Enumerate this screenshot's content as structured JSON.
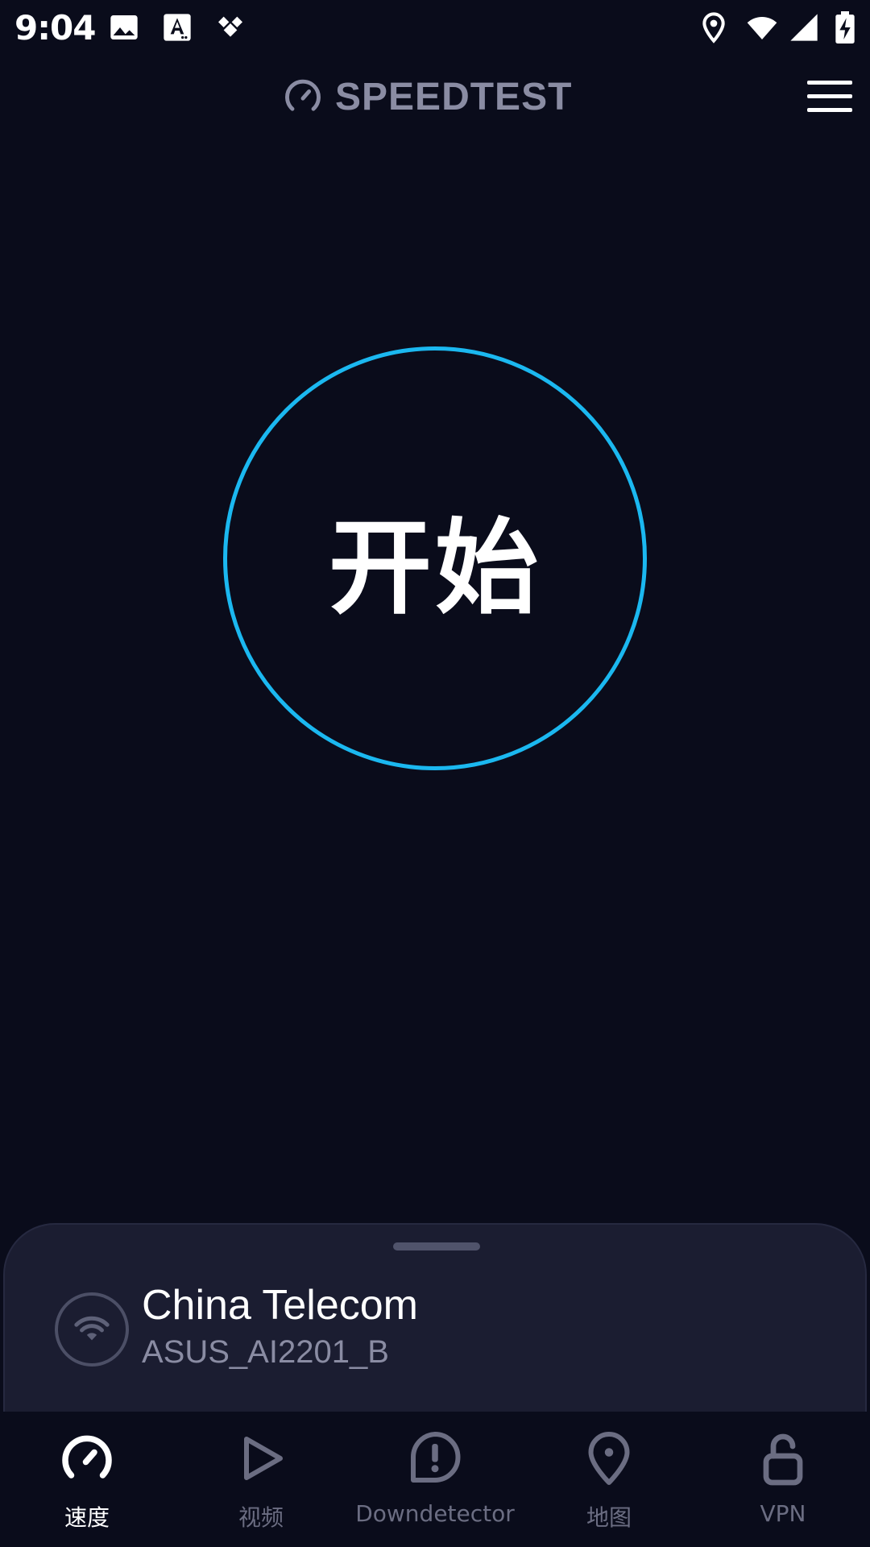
{
  "status_bar": {
    "time": "9:04",
    "left_icons": [
      "image-icon",
      "font-a-icon",
      "diamond-app-icon"
    ],
    "right_icons": [
      "location-icon",
      "wifi-icon",
      "signal-icon",
      "battery-charging-icon"
    ]
  },
  "header": {
    "logo_icon": "speedometer-icon",
    "title": "SPEEDTEST",
    "menu_icon": "hamburger-menu-icon"
  },
  "start": {
    "label": "开始"
  },
  "connection": {
    "icon": "wifi-icon",
    "provider": "China Telecom",
    "network": "ASUS_AI2201_B"
  },
  "nav": {
    "items": [
      {
        "label": "速度",
        "icon": "speedometer-icon",
        "active": true
      },
      {
        "label": "视频",
        "icon": "play-icon",
        "active": false
      },
      {
        "label": "Downdetector",
        "icon": "alert-bubble-icon",
        "active": false
      },
      {
        "label": "地图",
        "icon": "map-pin-icon",
        "active": false
      },
      {
        "label": "VPN",
        "icon": "unlock-icon",
        "active": false
      }
    ]
  },
  "colors": {
    "background": "#0a0c1b",
    "accent": "#1bb8f0",
    "sheet": "#1b1d31",
    "muted": "#8a8ca3"
  }
}
